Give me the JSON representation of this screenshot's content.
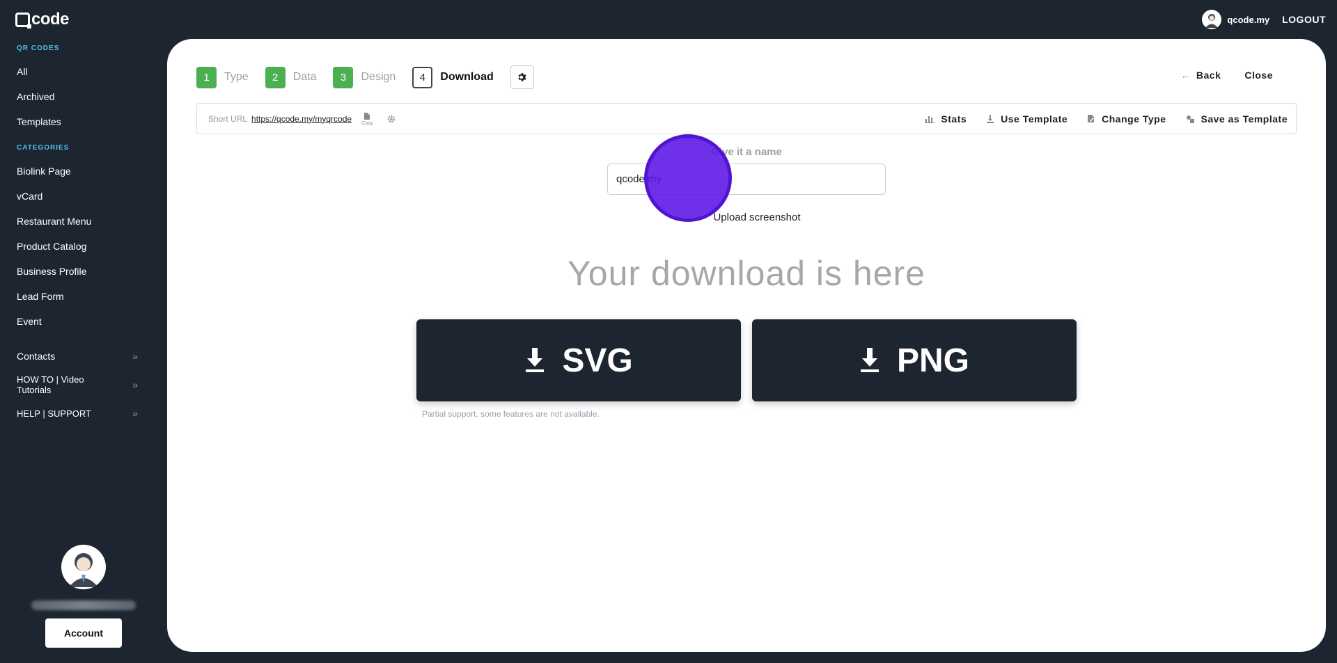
{
  "app": {
    "logo_text": "code"
  },
  "header": {
    "username": "qcode.my",
    "logout_label": "LOGOUT"
  },
  "sidebar": {
    "qr_label": "QR CODES",
    "qr_items": [
      "All",
      "Archived",
      "Templates"
    ],
    "categories_label": "CATEGORIES",
    "category_items": [
      "Biolink Page",
      "vCard",
      "Restaurant Menu",
      "Product Catalog",
      "Business Profile",
      "Lead Form",
      "Event"
    ],
    "expandable": [
      {
        "label": "Contacts"
      },
      {
        "label": "HOW TO | Video Tutorials"
      },
      {
        "label": "HELP | SUPPORT"
      }
    ],
    "account_label": "Account"
  },
  "stepper": [
    {
      "num": "1",
      "label": "Type"
    },
    {
      "num": "2",
      "label": "Data"
    },
    {
      "num": "3",
      "label": "Design"
    },
    {
      "num": "4",
      "label": "Download"
    }
  ],
  "top_actions": {
    "back": "Back",
    "close": "Close"
  },
  "urlbar": {
    "label": "Short URL",
    "url": "https://qcode.my/myqrcode",
    "copy_label": "Copy",
    "actions": {
      "stats": "Stats",
      "use_template": "Use Template",
      "change_type": "Change Type",
      "save_template": "Save as Template"
    }
  },
  "form": {
    "name_label": "Give it a name",
    "name_value": "qcode.my",
    "upload_label": "Upload screenshot"
  },
  "download": {
    "heading": "Your download is here",
    "svg_label": "SVG",
    "png_label": "PNG",
    "note": "Partial support, some features are not available."
  }
}
